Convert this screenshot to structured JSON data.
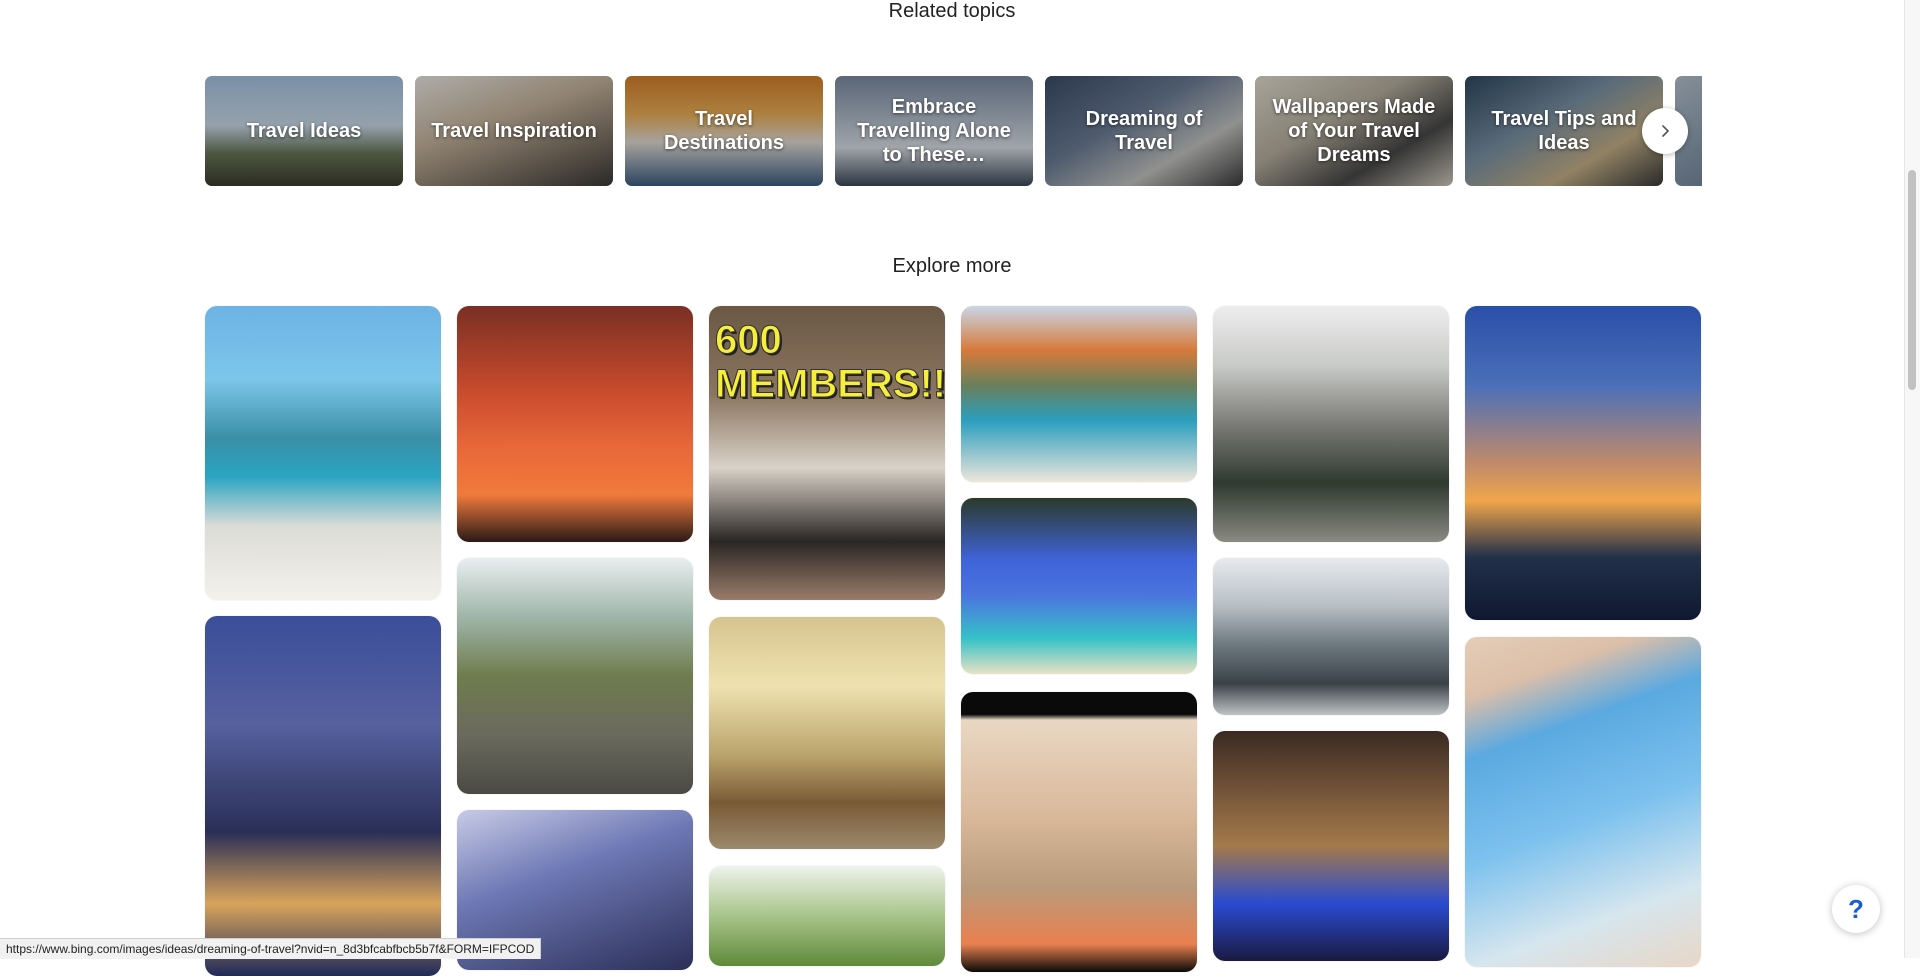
{
  "related": {
    "title": "Related topics",
    "topics": [
      {
        "label": "Travel Ideas",
        "bg": "linear-gradient(180deg,#a9c8e8 0%,#cfe0ef 45%,#6b7a5c 70%,#3c3d2e 100%)"
      },
      {
        "label": "Travel Inspiration",
        "bg": "linear-gradient(160deg,#f1efe9 0%,#c9b79f 40%,#7a6f62 75%,#3b3a38 100%)"
      },
      {
        "label": "Travel Destinations",
        "bg": "linear-gradient(180deg,#d9822b 0%,#f0b35a 35%,#e7e2da 60%,#3e5f86 100%)"
      },
      {
        "label": "Embrace Travelling Alone to These…",
        "bg": "linear-gradient(180deg,#7f8fa6 0%,#b6c2d1 40%,#dfe5ec 65%,#3d4a5c 100%)"
      },
      {
        "label": "Dreaming of Travel",
        "bg": "linear-gradient(150deg,#3d4f6a 0%,#6d7f99 40%,#c7c9c6 70%,#3c3c3c 100%)"
      },
      {
        "label": "Wallpapers Made of Your Travel Dreams",
        "bg": "linear-gradient(150deg,#e9e3d4 0%,#b9b2a1 40%,#4a4a4a 70%,#d8d2c4 100%)"
      },
      {
        "label": "Travel Tips and Ideas",
        "bg": "linear-gradient(150deg,#2e4a63 0%,#7d95a9 40%,#c9b48b 70%,#3b3b3b 100%)"
      },
      {
        "label": "",
        "bg": "linear-gradient(150deg,#b9c7d4 0%,#7f93a8 50%,#4b5a66 100%)"
      }
    ],
    "next_label": "›"
  },
  "explore": {
    "title": "Explore more",
    "tiles": [
      {
        "alt": "beach-villa-view",
        "bg": "linear-gradient(180deg,#6db3e6 0%,#7cc6e9 25%,#3a8fa6 45%,#2aa4c2 58%,#dcdcd6 75%,#f3f1ec 100%)"
      },
      {
        "alt": "dubai-night-skyline",
        "bg": "linear-gradient(180deg,#3b4e9a 0%,#56619f 30%,#2a2f57 60%,#d8a45a 80%,#1f2a5a 100%)"
      },
      {
        "alt": "airplane-sunset",
        "bg": "linear-gradient(180deg,#7a2f25 0%,#c64a2c 35%,#e9683a 60%,#f07a3b 80%,#2a1a16 100%)"
      },
      {
        "alt": "mountain-hiker",
        "bg": "linear-gradient(180deg,#e9eef0 0%,#9fb5a9 25%,#6f7c4e 50%,#6b6a5e 75%,#4a4a44 100%)"
      },
      {
        "alt": "airplane-window-dusk",
        "bg": "linear-gradient(160deg,#c7cbe6 0%,#6e78b4 40%,#2b2f58 100%)"
      },
      {
        "alt": "couple-train-600-members",
        "bg": "linear-gradient(180deg,#6b5844 0%,#8a7560 30%,#d9d2c8 55%,#2a2624 80%,#9a7c6a 100%)",
        "badge": "600 MEMBERS!!"
      },
      {
        "alt": "plane-over-city-suitcase",
        "bg": "linear-gradient(180deg,#d6c48e 0%,#efe2b0 30%,#b9a26a 60%,#7a5a36 80%,#9b8a6c 100%)"
      },
      {
        "alt": "green-trees",
        "bg": "linear-gradient(180deg,#eef3ec 0%,#a8c48a 50%,#5f8a3a 100%)"
      },
      {
        "alt": "moraine-lake",
        "bg": "linear-gradient(180deg,#c9d6e6 0%,#d77a3b 25%,#6a7f5a 45%,#2a9fbf 65%,#ece6da 100%)"
      },
      {
        "alt": "tropical-cove",
        "bg": "linear-gradient(180deg,#2c3a2a 0%,#3f63d8 35%,#4b74de 55%,#36c2c7 80%,#e8e1c4 100%)"
      },
      {
        "alt": "cappadocia-van-balloons",
        "bg": "linear-gradient(180deg,#0a0a0a 0%,#0a0a0a 8%,#e9d7c3 10%,#d9b89a 45%,#b99a7b 70%,#e9804f 90%,#0a0a0a 100%)"
      },
      {
        "alt": "granite-mountain-hiker",
        "bg": "linear-gradient(180deg,#ededed 0%,#c9cbc8 25%,#7c7c78 50%,#2f3a2f 75%,#8a8a82 100%)"
      },
      {
        "alt": "helicopter-glacier",
        "bg": "linear-gradient(180deg,#e7eaee 0%,#b8c0c6 30%,#6e7a80 55%,#3a4248 80%,#bfc3c5 100%)"
      },
      {
        "alt": "crystal-cave",
        "bg": "linear-gradient(180deg,#3a2a22 0%,#7c5a3c 30%,#a37a4a 50%,#2a4bd0 75%,#1a1a40 100%)"
      },
      {
        "alt": "wing-above-clouds",
        "bg": "linear-gradient(180deg,#2a4fa8 0%,#4a6fb8 25%,#c08a6a 50%,#f0a64a 62%,#22304a 80%,#0f1830 100%)"
      },
      {
        "alt": "airplane-window-wing",
        "bg": "linear-gradient(160deg,#e4cdb8 0%,#dcbfa8 15%,#5aa9e0 30%,#7cc1ee 55%,#d6e6ee 80%,#e8d6c6 100%)"
      }
    ]
  },
  "help": {
    "label": "?"
  },
  "status": {
    "url": "https://www.bing.com/images/ideas/dreaming-of-travel?nvid=n_8d3bfcabfbcb5b7f&FORM=IFPCOD"
  }
}
